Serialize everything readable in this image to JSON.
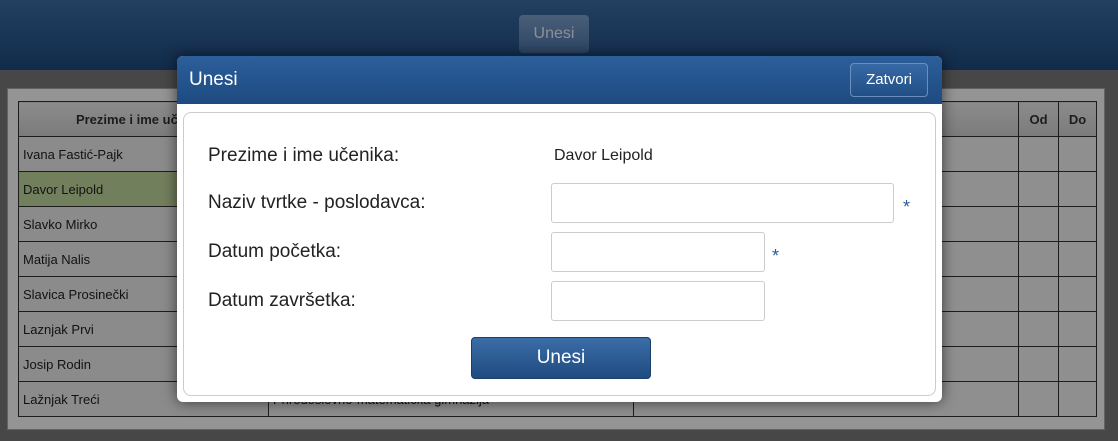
{
  "page": {
    "top_button_label": "Unesi"
  },
  "table": {
    "headers": [
      "Prezime i ime učenika",
      "",
      "",
      "Od",
      "Do"
    ],
    "rows": [
      {
        "name": "Ivana Fastić-Pajk",
        "school": ""
      },
      {
        "name": "Davor Leipold",
        "school": ""
      },
      {
        "name": "Slavko Mirko",
        "school": ""
      },
      {
        "name": "Matija Nalis",
        "school": ""
      },
      {
        "name": "Slavica Prosinečki",
        "school": ""
      },
      {
        "name": "Laznjak Prvi",
        "school": ""
      },
      {
        "name": "Josip Rodin",
        "school": ""
      },
      {
        "name": "Lažnjak Treći",
        "school": "Prirodoslovno-matematička gimnazija"
      }
    ],
    "selected_row": 1
  },
  "dialog": {
    "title": "Unesi",
    "close_label": "Zatvori",
    "student_label": "Prezime i ime učenika:",
    "student_value": "Davor Leipold",
    "employer_label": "Naziv tvrtke - poslodavca:",
    "employer_value": "",
    "start_label": "Datum početka:",
    "start_value": "",
    "end_label": "Datum završetka:",
    "end_value": "",
    "required_mark": "*",
    "submit_label": "Unesi"
  }
}
